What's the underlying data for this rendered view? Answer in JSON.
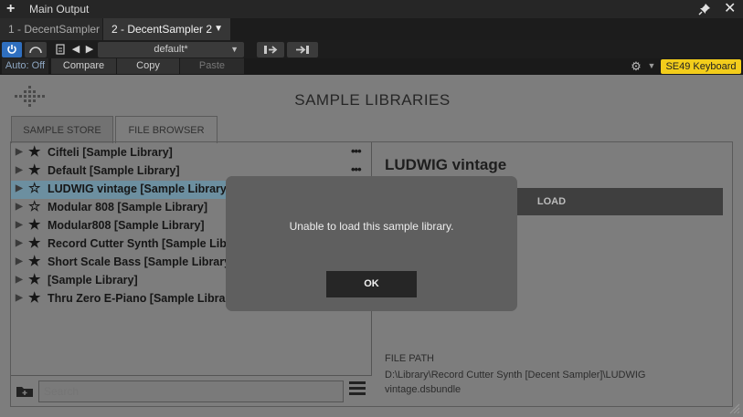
{
  "window": {
    "title": "Main Output",
    "tabs": [
      {
        "label": "1 - DecentSampler"
      },
      {
        "label": "2 - DecentSampler 2"
      }
    ]
  },
  "toolbar": {
    "preset": "default*",
    "auto_label": "Auto: Off",
    "compare_label": "Compare",
    "copy_label": "Copy",
    "paste_label": "Paste",
    "device": "SE49 Keyboard"
  },
  "plugin": {
    "title": "SAMPLE LIBRARIES",
    "tabs": {
      "store": "SAMPLE STORE",
      "browser": "FILE BROWSER"
    },
    "libraries": [
      {
        "name": "Cifteli [Sample Library]",
        "favorite": true,
        "menu": "•••"
      },
      {
        "name": "Default [Sample Library]",
        "favorite": true,
        "menu": "•••"
      },
      {
        "name": "LUDWIG vintage [Sample Library]",
        "favorite": false,
        "selected": true,
        "menu": "•••"
      },
      {
        "name": "Modular 808 [Sample Library]",
        "favorite": false,
        "menu": "•••"
      },
      {
        "name": "Modular808 [Sample Library]",
        "favorite": true,
        "menu": "•••"
      },
      {
        "name": "Record Cutter Synth [Sample Library]",
        "favorite": true,
        "menu": "•••"
      },
      {
        "name": "Short Scale Bass [Sample Library]",
        "favorite": true,
        "menu": "•••"
      },
      {
        "name": " [Sample Library]",
        "favorite": true,
        "menu": "•••"
      },
      {
        "name": "Thru Zero E-Piano [Sample Library]",
        "favorite": true,
        "menu": "•••"
      }
    ],
    "search_placeholder": "Search",
    "detail": {
      "title": "LUDWIG vintage",
      "load_label": "LOAD",
      "file_path_label": "FILE PATH",
      "file_path": "D:\\Library\\Record Cutter Synth [Decent Sampler]\\LUDWIG vintage.dsbundle"
    }
  },
  "dialog": {
    "message": "Unable to load this sample library.",
    "ok_label": "OK"
  },
  "colors": {
    "accent_blue": "#2f6fbf",
    "device_badge": "#f3cd1b",
    "selected_row": "#6c8fa0"
  }
}
